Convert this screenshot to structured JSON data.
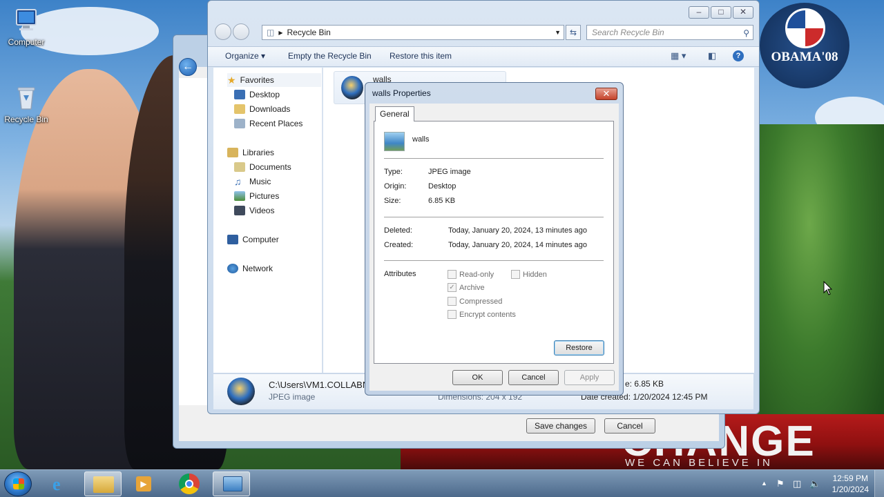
{
  "desktop": {
    "icons": [
      {
        "label": "Computer"
      },
      {
        "label": "Recycle Bin"
      }
    ],
    "logo_text": "OBAMA'08",
    "banner_text": "CHANGE",
    "banner_sub": "WE CAN BELIEVE IN"
  },
  "explorer": {
    "address": "Recycle Bin",
    "search_placeholder": "Search Recycle Bin",
    "toolbar": {
      "organize": "Organize",
      "empty": "Empty the Recycle Bin",
      "restore": "Restore this item"
    },
    "nav": {
      "favorites": "Favorites",
      "desktop": "Desktop",
      "downloads": "Downloads",
      "recent": "Recent Places",
      "libraries": "Libraries",
      "documents": "Documents",
      "music": "Music",
      "pictures": "Pictures",
      "videos": "Videos",
      "computer": "Computer",
      "network": "Network"
    },
    "file_name": "walls",
    "details": {
      "path": "C:\\Users\\VM1.COLLABN",
      "type": "JPEG image",
      "dimensions": "Dimensions: 204 x 192",
      "size": "e: 6.85 KB",
      "date_created": "Date created: 1/20/2024 12:45 PM"
    }
  },
  "properties": {
    "title": "walls Properties",
    "tab": "General",
    "file_name": "walls",
    "type_label": "Type:",
    "type_value": "JPEG image",
    "origin_label": "Origin:",
    "origin_value": "Desktop",
    "size_label": "Size:",
    "size_value": "6.85 KB",
    "deleted_label": "Deleted:",
    "deleted_value": "Today, January 20, 2024, 13 minutes ago",
    "created_label": "Created:",
    "created_value": "Today, January 20, 2024, 14 minutes ago",
    "attributes_label": "Attributes",
    "attributes": {
      "readonly": "Read-only",
      "hidden": "Hidden",
      "archive": "Archive",
      "compressed": "Compressed",
      "encrypt": "Encrypt contents"
    },
    "restore_button": "Restore",
    "ok_button": "OK",
    "cancel_button": "Cancel",
    "apply_button": "Apply"
  },
  "back_window": {
    "save_button": "Save changes",
    "cancel_button": "Cancel"
  },
  "taskbar": {
    "time": "12:59 PM",
    "date": "1/20/2024"
  },
  "colors": {
    "accent": "#3c7fb1",
    "close_red": "#c4422a"
  }
}
